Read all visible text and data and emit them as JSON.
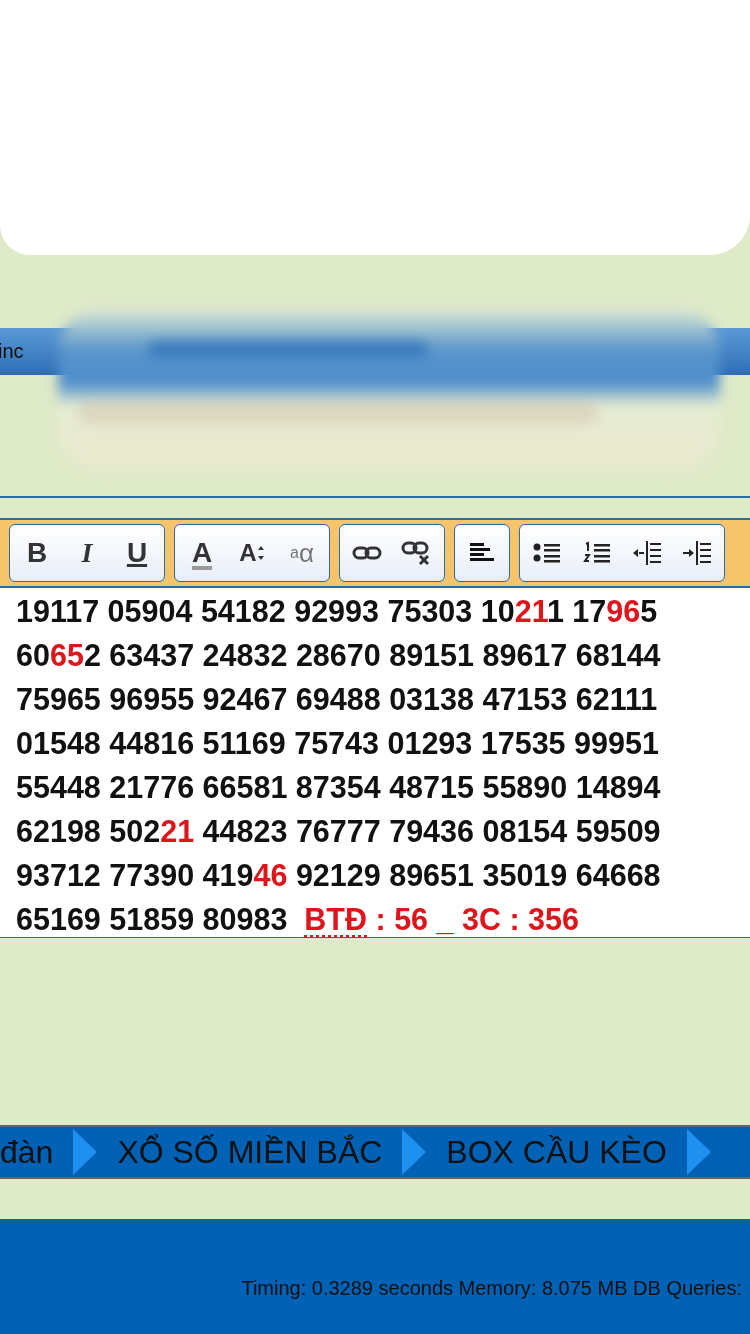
{
  "header_bar": {
    "text": "inc"
  },
  "toolbar": {
    "groups": [
      {
        "buttons": [
          {
            "kind": "bold",
            "label": "B"
          },
          {
            "kind": "italic",
            "label": "I"
          },
          {
            "kind": "underline",
            "label": "U"
          }
        ]
      },
      {
        "buttons": [
          {
            "kind": "font-color",
            "label": "A"
          },
          {
            "kind": "font-size",
            "label": "A"
          },
          {
            "kind": "case",
            "label": "$^{a}$α"
          }
        ]
      },
      {
        "buttons": [
          {
            "kind": "link"
          },
          {
            "kind": "unlink"
          }
        ]
      },
      {
        "buttons": [
          {
            "kind": "align-left"
          }
        ]
      },
      {
        "buttons": [
          {
            "kind": "bullet-list"
          },
          {
            "kind": "numbered-list"
          },
          {
            "kind": "outdent"
          },
          {
            "kind": "indent"
          }
        ]
      }
    ]
  },
  "editor": {
    "lines": [
      [
        {
          "text": "19117 05904 54182 92993 75303 10",
          "kind": "plain"
        },
        {
          "text": "21",
          "kind": "highlight"
        },
        {
          "text": "1 17",
          "kind": "plain"
        },
        {
          "text": "96",
          "kind": "highlight"
        },
        {
          "text": "5",
          "kind": "plain"
        }
      ],
      [
        {
          "text": "60",
          "kind": "plain"
        },
        {
          "text": "65",
          "kind": "highlight"
        },
        {
          "text": "2 63437 24832 28670 89151 89617 68144",
          "kind": "plain"
        }
      ],
      [
        {
          "text": "75965 96955 92467 69488 03138 47153 62111",
          "kind": "plain"
        }
      ],
      [
        {
          "text": "01548 44816 51169 75743 01293 17535 99951",
          "kind": "plain"
        }
      ],
      [
        {
          "text": "55448 21776 66581 87354 48715 55890 14894",
          "kind": "plain"
        }
      ],
      [
        {
          "text": "62198 502",
          "kind": "plain"
        },
        {
          "text": "21",
          "kind": "highlight"
        },
        {
          "text": " 44823 76777 79436 08154 59509",
          "kind": "plain"
        }
      ],
      [
        {
          "text": "93712 77390 419",
          "kind": "plain"
        },
        {
          "text": "46",
          "kind": "highlight"
        },
        {
          "text": " 92129 89651 35019 64668",
          "kind": "plain"
        }
      ],
      [
        {
          "text": "65169 51859 80983  ",
          "kind": "plain"
        },
        {
          "text": "BTĐ",
          "kind": "flagged"
        },
        {
          "text": " : 56 _ 3C : 356",
          "kind": "highlight"
        }
      ]
    ]
  },
  "breadcrumb": {
    "items": [
      "đàn",
      "XỔ SỐ MIỀN BẮC",
      "BOX CẦU KÈO"
    ]
  },
  "footer": {
    "text": "Timing: 0.3289 seconds Memory: 8.075 MB DB Queries:"
  }
}
